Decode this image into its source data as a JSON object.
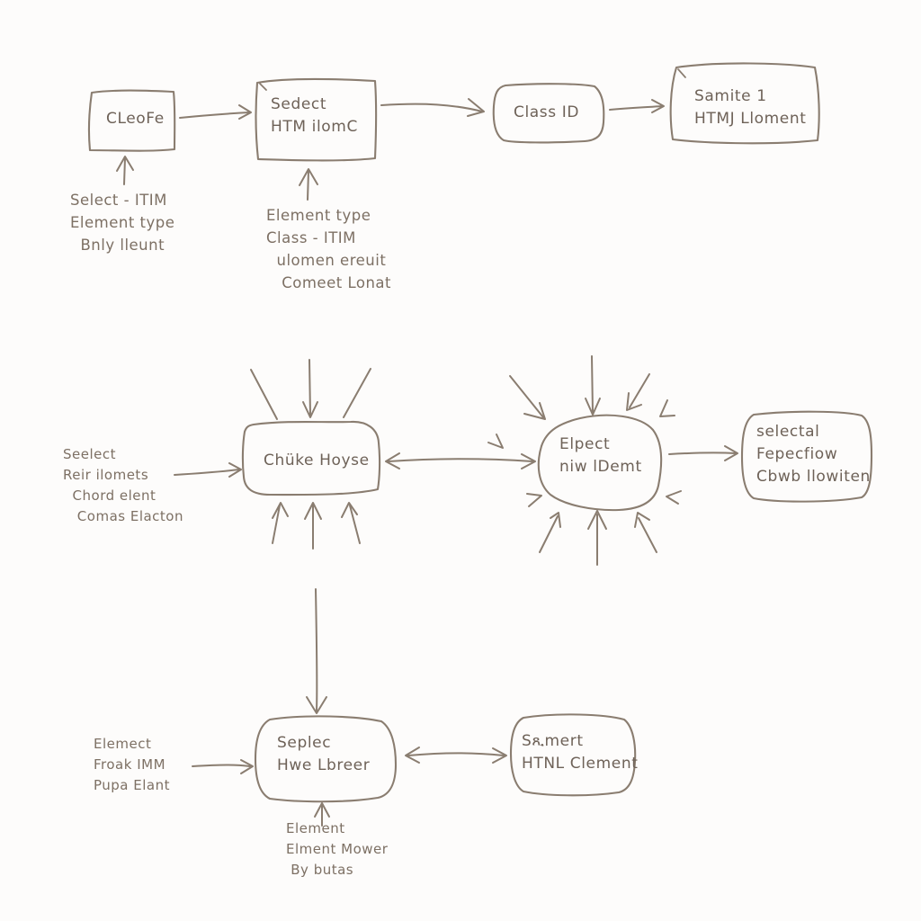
{
  "diagram": {
    "title": "hand-drawn html element selection flow",
    "stroke_color": "#8a7d70",
    "text_color": "#6e6258",
    "background_color": "#fdfcfb",
    "nodes": [
      {
        "id": "n1",
        "label": "CLeoFe"
      },
      {
        "id": "n2",
        "label": "Sedect\nHTM ilomC"
      },
      {
        "id": "n3",
        "label": "Class ID"
      },
      {
        "id": "n4",
        "label": "Samite 1\nHTMJ Lloment"
      },
      {
        "id": "n5",
        "label": "Chüke Hoyse"
      },
      {
        "id": "n6",
        "label": "Elpect\nniw lDemt"
      },
      {
        "id": "n7",
        "label": "selectal\nFepecfiow\nCbwb llowiten"
      },
      {
        "id": "n8",
        "label": "Seplec\nHwe Lbreer"
      },
      {
        "id": "n9",
        "label": "Sጺmert\nHTNL Clement"
      }
    ],
    "annotations": [
      {
        "id": "a1",
        "text": "Select - ITIM\nElement type\n  Bnly lleunt"
      },
      {
        "id": "a2",
        "text": "Element type\nClass - ITIM\n  ulomen ereuit\n   Comeet Lonat"
      },
      {
        "id": "a3",
        "text": "Seelect\nReir ilomets\n  Chord elent\n   Comas Elacton"
      },
      {
        "id": "a4",
        "text": "Elemect\nFroak IMM\nPupa Elant"
      },
      {
        "id": "a5",
        "text": "Element\nElment Mower\n By butas"
      }
    ]
  }
}
